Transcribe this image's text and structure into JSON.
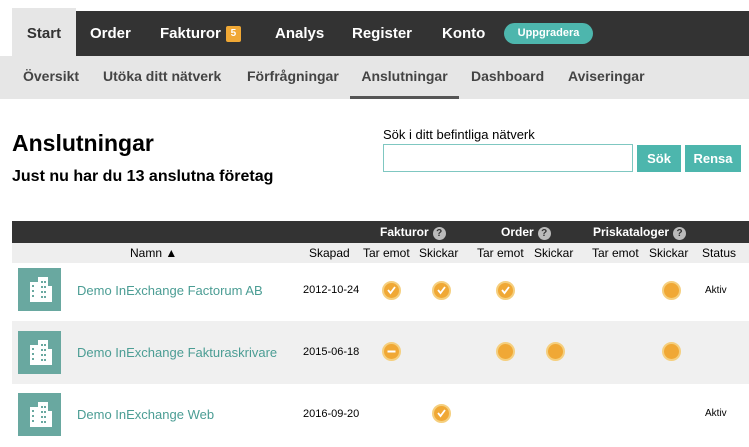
{
  "topnav": {
    "items": [
      {
        "label": "Start"
      },
      {
        "label": "Order"
      },
      {
        "label": "Fakturor",
        "badge": "5"
      },
      {
        "label": "Analys"
      },
      {
        "label": "Register"
      },
      {
        "label": "Konto"
      }
    ],
    "upgrade": "Uppgradera"
  },
  "subnav": {
    "items": [
      "Översikt",
      "Utöka ditt nätverk",
      "Förfrågningar",
      "Anslutningar",
      "Dashboard",
      "Aviseringar"
    ]
  },
  "page": {
    "title": "Anslutningar",
    "subtitle": "Just nu har du 13 anslutna företag"
  },
  "search": {
    "label": "Sök i ditt befintliga nätverk",
    "value": "",
    "search_button": "Sök",
    "clear_button": "Rensa"
  },
  "table": {
    "groups": [
      "Fakturor",
      "Order",
      "Priskataloger"
    ],
    "columns": {
      "name": "Namn ▲",
      "created": "Skapad",
      "receives": "Tar emot",
      "sends": "Skickar",
      "status": "Status"
    },
    "rows": [
      {
        "name": "Demo InExchange Factorum AB",
        "created": "2012-10-24",
        "cells": {
          "inv_recv": "check",
          "inv_send": "check",
          "ord_recv": "check",
          "ord_send": "",
          "pc_recv": "",
          "pc_send": "full"
        },
        "status": "Aktiv"
      },
      {
        "name": "Demo InExchange Fakturaskrivare",
        "created": "2015-06-18",
        "cells": {
          "inv_recv": "minus",
          "inv_send": "",
          "ord_recv": "full",
          "ord_send": "full",
          "pc_recv": "",
          "pc_send": "full"
        },
        "status": ""
      },
      {
        "name": "Demo InExchange Web",
        "created": "2016-09-20",
        "cells": {
          "inv_recv": "",
          "inv_send": "check",
          "ord_recv": "",
          "ord_send": "",
          "pc_recv": "",
          "pc_send": ""
        },
        "status": "Aktiv"
      }
    ]
  },
  "colors": {
    "accent": "#4db6ad",
    "dark": "#333333",
    "orange": "#f0a835",
    "link": "#4b9d94"
  }
}
